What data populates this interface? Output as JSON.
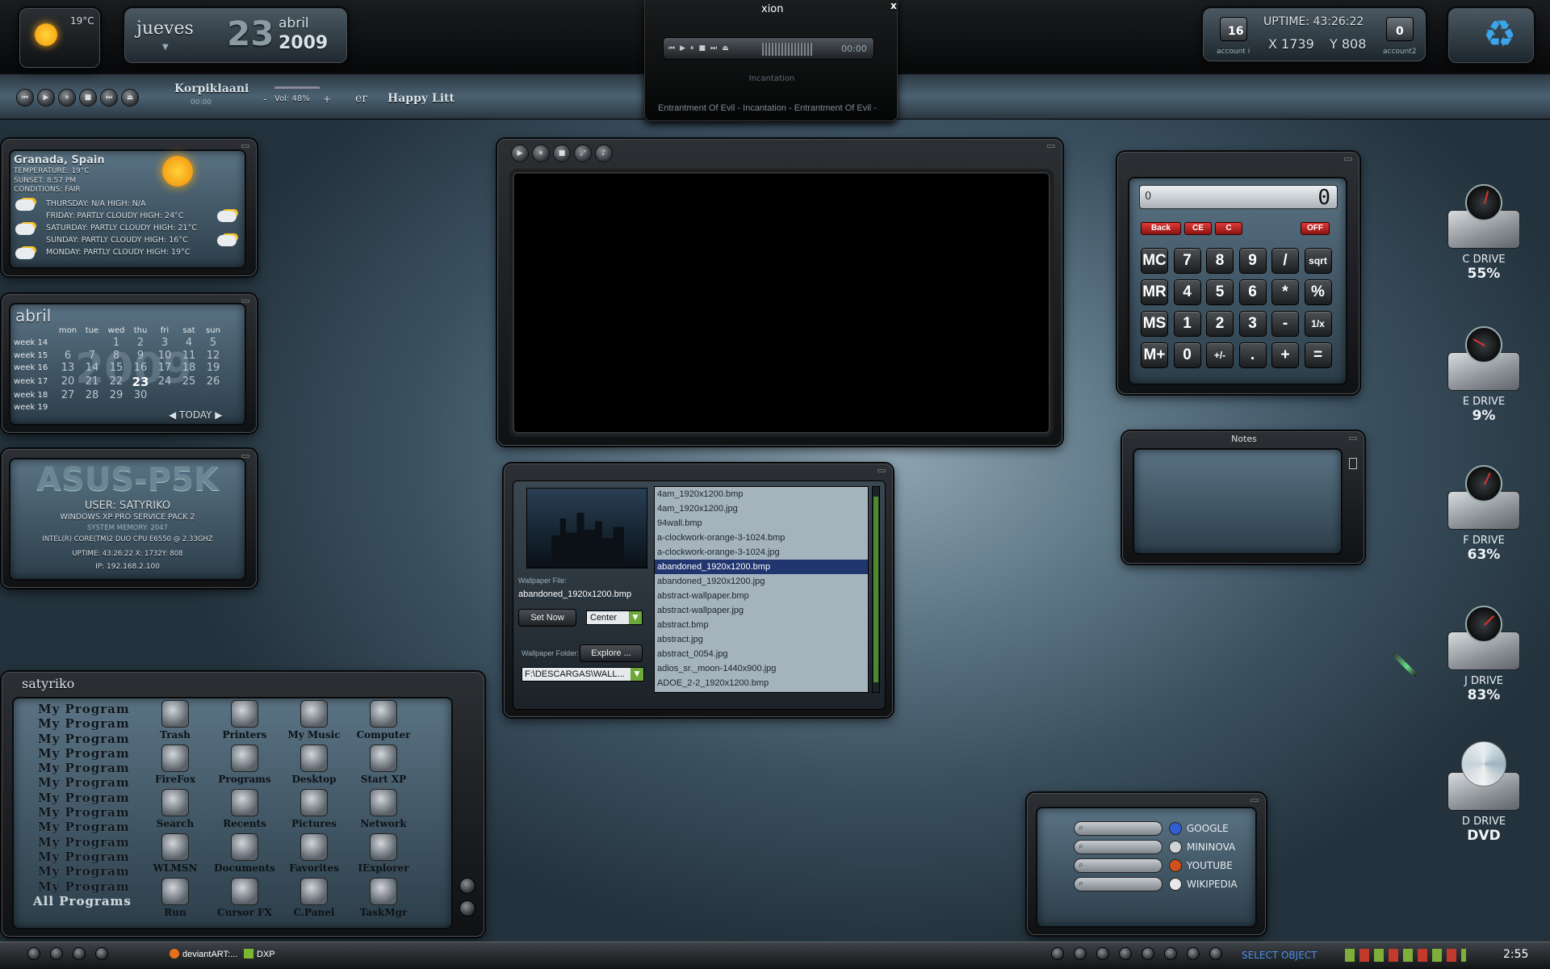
{
  "topbar": {
    "weather_temp": "19°C",
    "date": {
      "weekday": "jueves",
      "day": "23",
      "month": "abril",
      "year": "2009"
    },
    "media": {
      "artist": "Korpiklaani",
      "sub": "00:00",
      "volume": "Vol: 48%",
      "vol_minus": "-",
      "vol_plus": "+",
      "song_scroll": "er",
      "song2": "Happy Litt"
    },
    "stats": {
      "account1_count": "16",
      "account1_label": "account i",
      "uptime": "UPTIME: 43:26:22",
      "x": "X  1739",
      "y": "Y  808",
      "account2_count": "0",
      "account2_label": "account2"
    }
  },
  "xion": {
    "title": "xion",
    "close": "x",
    "time": "00:00",
    "track": "Incantation",
    "scroll": "Entrantment Of Evil - Incantation - Entrantment Of Evil -"
  },
  "weather": {
    "location": "Granada, Spain",
    "temperature": "TEMPERATURE: 19°C",
    "sunset": "SUNSET: 8:57 PM",
    "conditions": "CONDITIONS: FAIR",
    "forecast": [
      "THURSDAY: N/A HIGH: N/A",
      "FRIDAY: PARTLY CLOUDY HIGH: 24°C",
      "SATURDAY: PARTLY CLOUDY HIGH: 21°C",
      "SUNDAY: PARTLY CLOUDY HIGH: 16°C",
      "MONDAY: PARTLY CLOUDY HIGH: 19°C"
    ]
  },
  "calendar": {
    "month": "abril",
    "watermark": "2009",
    "today_label": "TODAY",
    "days": [
      "mon",
      "tue",
      "wed",
      "thu",
      "fri",
      "sat",
      "sun"
    ],
    "weeks": [
      {
        "label": "week 14",
        "d": [
          "",
          "",
          "1",
          "2",
          "3",
          "4",
          "5"
        ]
      },
      {
        "label": "week 15",
        "d": [
          "6",
          "7",
          "8",
          "9",
          "10",
          "11",
          "12"
        ]
      },
      {
        "label": "week 16",
        "d": [
          "13",
          "14",
          "15",
          "16",
          "17",
          "18",
          "19"
        ]
      },
      {
        "label": "week 17",
        "d": [
          "20",
          "21",
          "22",
          "23",
          "24",
          "25",
          "26"
        ]
      },
      {
        "label": "week 18",
        "d": [
          "27",
          "28",
          "29",
          "30",
          "",
          "",
          ""
        ]
      },
      {
        "label": "week 19",
        "d": [
          "",
          "",
          "",
          "",
          "",
          "",
          ""
        ]
      }
    ]
  },
  "sysinfo": {
    "host": "ASUS-P5K",
    "user": "USER: SATYRIKO",
    "os": "WINDOWS XP PRO SERVICE PACK 2",
    "memory": "SYSTEM MEMORY: 2047",
    "cpu": "INTEL(R) CORE(TM)2 DUO CPU     E6550  @ 2.33GHZ",
    "uptime": "UPTIME:     43:26:22      X: 1732Y: 808",
    "ip": "IP: 192.168.2.100"
  },
  "calculator": {
    "memory": "0",
    "display": "0",
    "red_keys": [
      "Back",
      "CE",
      "C",
      "OFF"
    ],
    "keys": [
      [
        "MC",
        "7",
        "8",
        "9",
        "/",
        "sqrt"
      ],
      [
        "MR",
        "4",
        "5",
        "6",
        "*",
        "%"
      ],
      [
        "MS",
        "1",
        "2",
        "3",
        "-",
        "1/x"
      ],
      [
        "M+",
        "0",
        "+/-",
        ".",
        "+",
        "="
      ]
    ]
  },
  "notes": {
    "title": "Notes"
  },
  "wallpaper": {
    "file_label": "Wallpaper File:",
    "file_value": "abandoned_1920x1200.bmp",
    "set_now": "Set Now",
    "mode": "Center",
    "folder_label": "Wallpaper Folder:",
    "explore": "Explore ...",
    "folder_value": "F:\\DESCARGAS\\WALL...",
    "files": [
      "4am_1920x1200.bmp",
      "4am_1920x1200.jpg",
      "94wall.bmp",
      "a-clockwork-orange-3-1024.bmp",
      "a-clockwork-orange-3-1024.jpg",
      "abandoned_1920x1200.bmp",
      "abandoned_1920x1200.jpg",
      "abstract-wallpaper.bmp",
      "abstract-wallpaper.jpg",
      "abstract.bmp",
      "abstract.jpg",
      "abstract_0054.jpg",
      "adios_sr._moon-1440x900.jpg",
      "ADOE_2-2_1920x1200.bmp"
    ],
    "selected_index": 5
  },
  "launcher": {
    "title": "satyriko",
    "program_label": "My Program",
    "program_count": 13,
    "all_programs": "All Programs",
    "icons": [
      "Trash",
      "Printers",
      "My Music",
      "Computer",
      "FireFox",
      "Programs",
      "Desktop",
      "Start XP",
      "Search",
      "Recents",
      "Pictures",
      "Network",
      "WLMSN",
      "Documents",
      "Favorites",
      "IExplorer",
      "Run",
      "Cursor FX",
      "C.Panel",
      "TaskMgr"
    ]
  },
  "search": {
    "engines": [
      "GOOGLE",
      "MININOVA",
      "YOUTUBE",
      "WIKIPEDIA"
    ],
    "colors": [
      "#2f5fd0",
      "#cfd3d6",
      "#d2501c",
      "#e8e8e8"
    ]
  },
  "drives": [
    {
      "label": "C DRIVE",
      "value": "55%",
      "angle": 15
    },
    {
      "label": "E DRIVE",
      "value": "9%",
      "angle": -60
    },
    {
      "label": "F DRIVE",
      "value": "63%",
      "angle": 25
    },
    {
      "label": "J DRIVE",
      "value": "83%",
      "angle": 45
    },
    {
      "label": "D DRIVE",
      "value": "DVD",
      "angle": 0
    }
  ],
  "taskbar": {
    "items": [
      "deviantART:...",
      "DXP"
    ],
    "status": "SELECT OBJECT",
    "clock": "2:55"
  }
}
